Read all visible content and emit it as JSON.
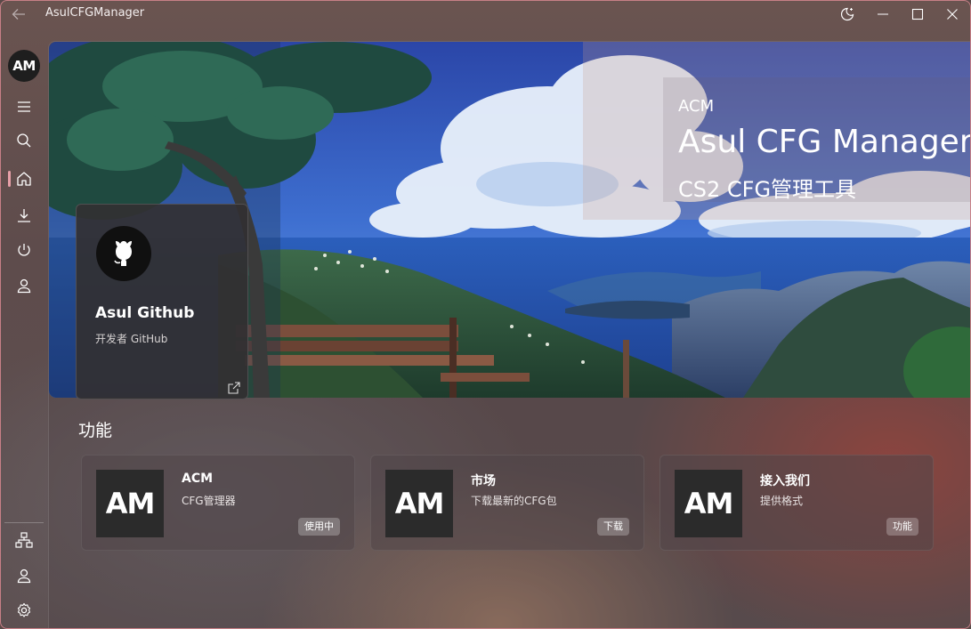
{
  "window": {
    "title": "AsulCFGManager"
  },
  "sidebar": {
    "avatar_text": "AM",
    "items": [
      {
        "icon": "menu-icon"
      },
      {
        "icon": "search-icon"
      },
      {
        "icon": "home-icon",
        "active": true
      },
      {
        "icon": "download-icon"
      },
      {
        "icon": "power-icon"
      },
      {
        "icon": "user-icon"
      }
    ],
    "footer_items": [
      {
        "icon": "network-icon"
      },
      {
        "icon": "account-icon"
      },
      {
        "icon": "settings-icon"
      }
    ]
  },
  "hero": {
    "subtitle": "ACM",
    "title": "Asul CFG Manager",
    "description": "CS2 CFG管理工具"
  },
  "github_card": {
    "name": "Asul Github",
    "subtitle": "开发者 GitHub"
  },
  "features": {
    "title": "功能",
    "cards": [
      {
        "logo": "AM",
        "title": "ACM",
        "description": "CFG管理器",
        "badge": "使用中"
      },
      {
        "logo": "AM",
        "title": "市场",
        "description": "下载最新的CFG包",
        "badge": "下载"
      },
      {
        "logo": "AM",
        "title": "接入我们",
        "description": "提供格式",
        "badge": "功能"
      }
    ]
  },
  "colors": {
    "accent": "#e7a0a8",
    "card_logo_bg": "#2b2b2b"
  }
}
